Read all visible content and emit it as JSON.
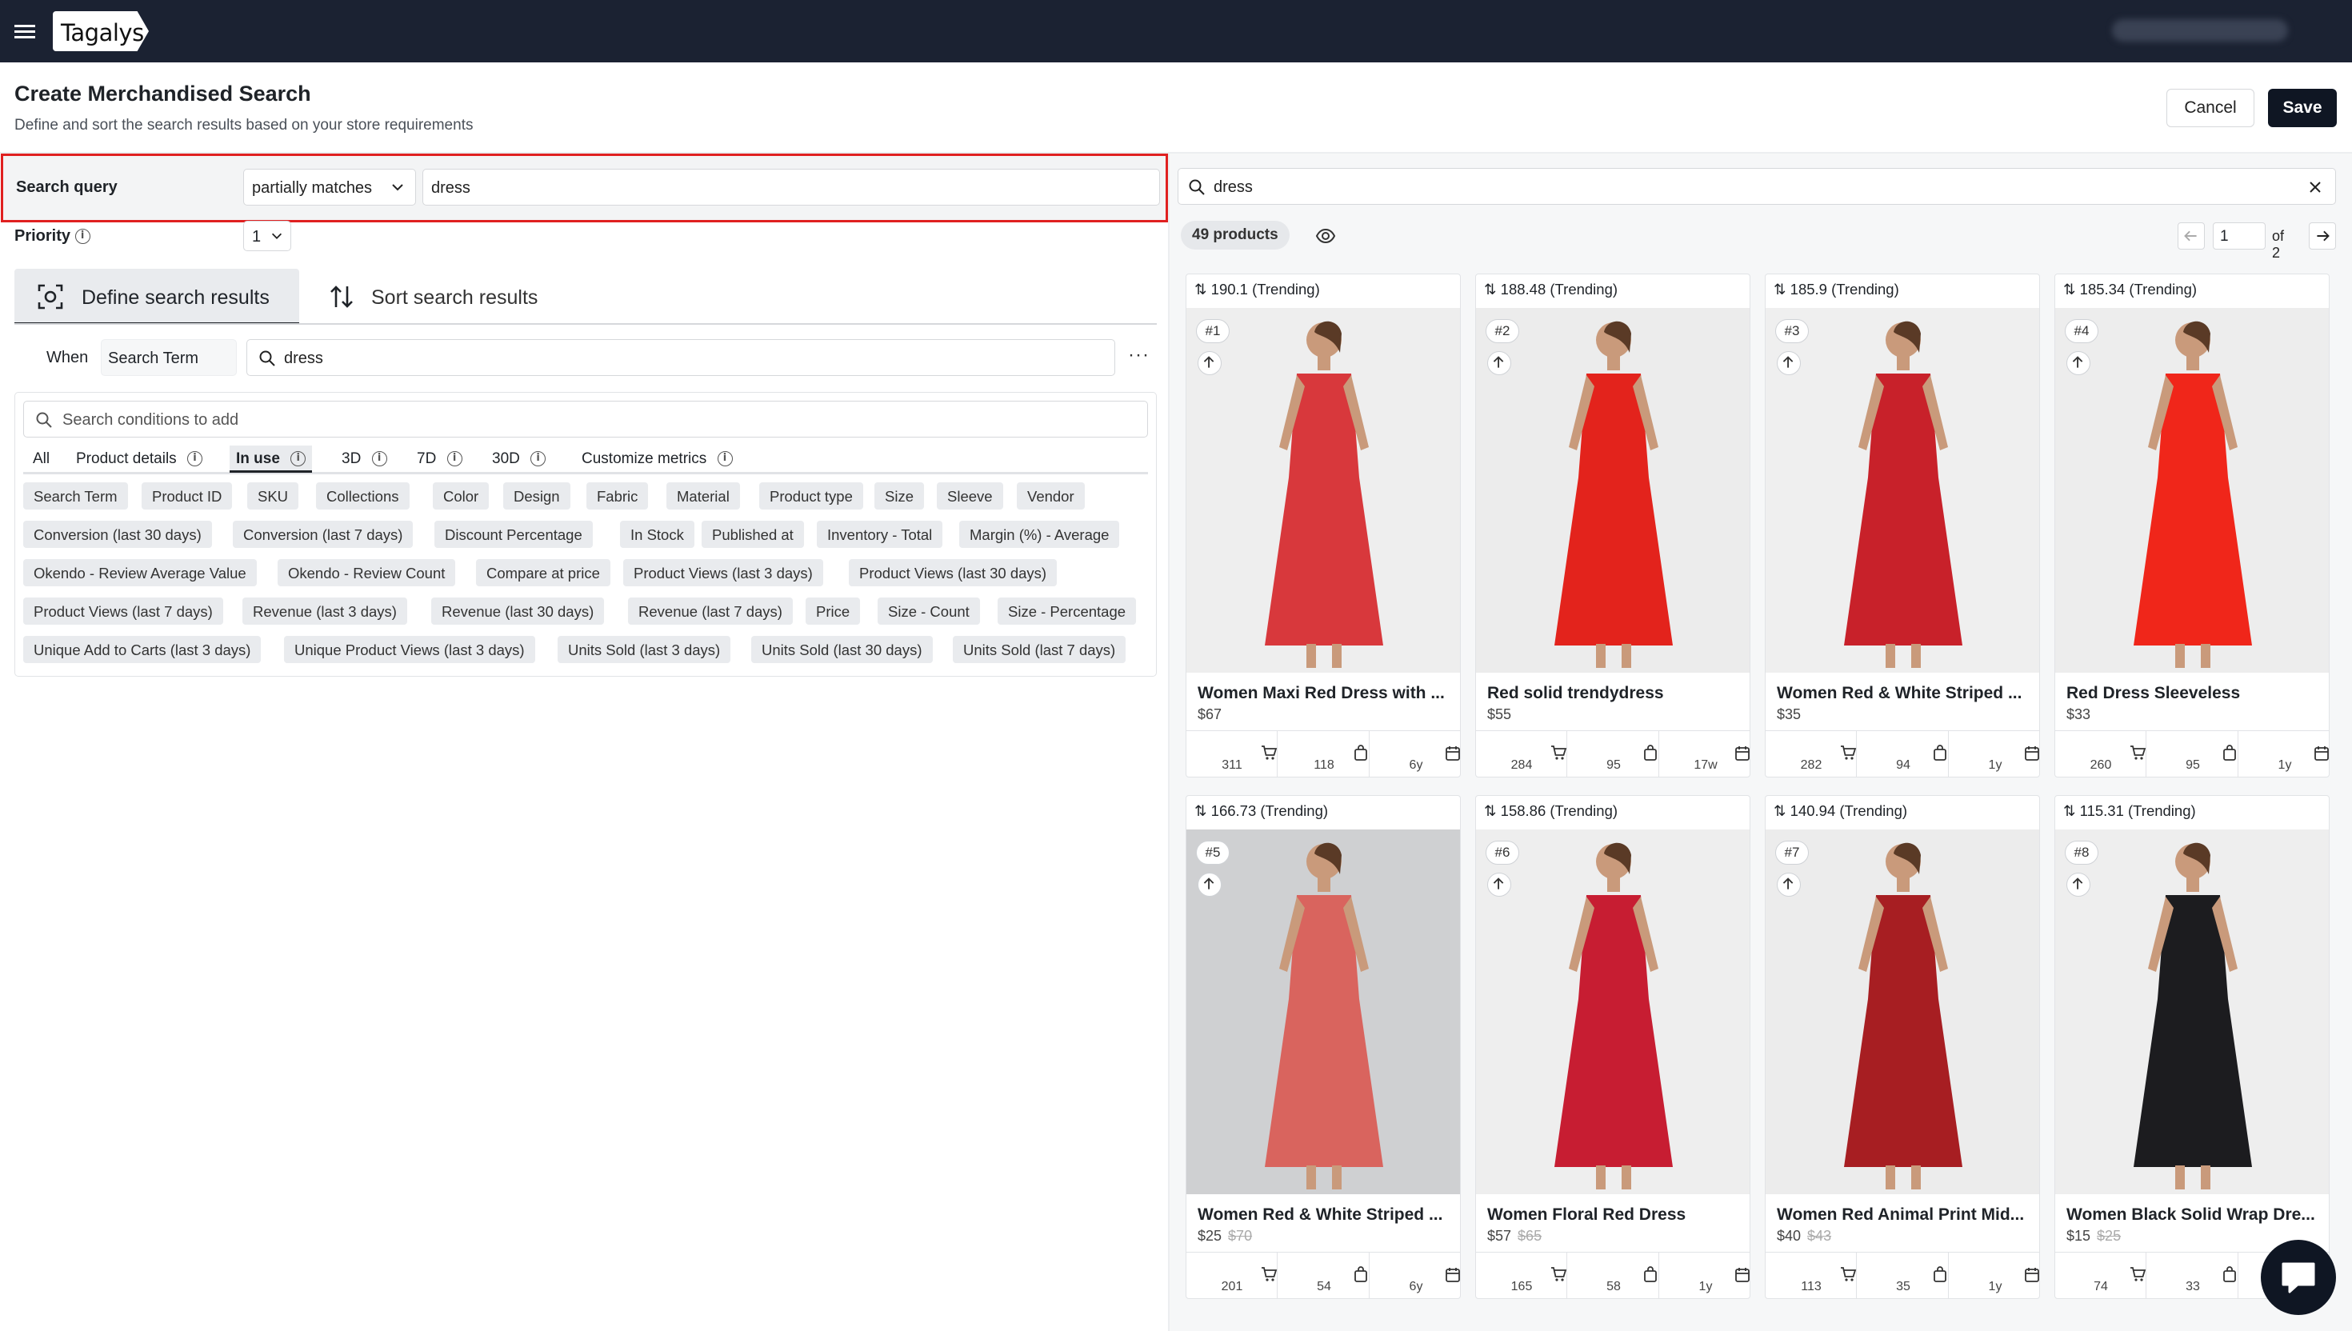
{
  "app": {
    "logo": "Tagalys"
  },
  "header": {
    "title": "Create Merchandised Search",
    "subtitle": "Define and sort the search results based on your store requirements",
    "cancel_label": "Cancel",
    "save_label": "Save"
  },
  "search_query": {
    "label": "Search query",
    "match_type": "partially matches",
    "value": "dress"
  },
  "priority": {
    "label": "Priority",
    "value": "1"
  },
  "tabs": [
    {
      "label": "Define search results",
      "active": true
    },
    {
      "label": "Sort search results",
      "active": false
    }
  ],
  "condition": {
    "when_label": "When",
    "field": "Search Term",
    "value": "dress"
  },
  "conditions_panel": {
    "search_placeholder": "Search conditions to add",
    "filters": [
      "All",
      "Product details",
      "In use",
      "3D",
      "7D",
      "30D",
      "Customize metrics"
    ],
    "active_filter": "In use",
    "chips": [
      [
        "Search Term",
        "Product ID",
        "SKU",
        "Collections",
        "Color",
        "Design",
        "Fabric",
        "Material",
        "Product type",
        "Size",
        "Sleeve",
        "Vendor"
      ],
      [
        "Conversion (last 30 days)",
        "Conversion (last 7 days)",
        "Discount Percentage",
        "In Stock",
        "Published at",
        "Inventory - Total",
        "Margin (%) - Average"
      ],
      [
        "Okendo - Review Average Value",
        "Okendo - Review Count",
        "Compare at price",
        "Product Views (last 3 days)",
        "Product Views (last 30 days)"
      ],
      [
        "Product Views (last 7 days)",
        "Revenue (last 3 days)",
        "Revenue (last 30 days)",
        "Revenue (last 7 days)",
        "Price",
        "Size - Count",
        "Size - Percentage"
      ],
      [
        "Unique Add to Carts (last 3 days)",
        "Unique Product Views (last 3 days)",
        "Units Sold (last 3 days)",
        "Units Sold (last 30 days)",
        "Units Sold (last 7 days)"
      ]
    ]
  },
  "results": {
    "search_value": "dress",
    "count_label": "49 products",
    "page": "1",
    "of_label": "of 2",
    "products": [
      {
        "score": "190.1 (Trending)",
        "rank": "#1",
        "name": "Women Maxi Red Dress with ...",
        "price": "$67",
        "orig": "",
        "carts": "311",
        "bags": "118",
        "age": "6y",
        "dress_color": "#d8383c",
        "bg": "#eeeeee"
      },
      {
        "score": "188.48 (Trending)",
        "rank": "#2",
        "name": "Red solid trendydress",
        "price": "$55",
        "orig": "",
        "carts": "284",
        "bags": "95",
        "age": "17w",
        "dress_color": "#e3231c",
        "bg": "#ececec"
      },
      {
        "score": "185.9 (Trending)",
        "rank": "#3",
        "name": "Women Red & White Striped ...",
        "price": "$35",
        "orig": "",
        "carts": "282",
        "bags": "94",
        "age": "1y",
        "dress_color": "#c8212a",
        "bg": "#efefef"
      },
      {
        "score": "185.34 (Trending)",
        "rank": "#4",
        "name": "Red Dress Sleeveless",
        "price": "$33",
        "orig": "",
        "carts": "260",
        "bags": "95",
        "age": "1y",
        "dress_color": "#f0261a",
        "bg": "#ededed"
      },
      {
        "score": "166.73 (Trending)",
        "rank": "#5",
        "name": "Women Red & White Striped ...",
        "price": "$25",
        "orig": "$70",
        "carts": "201",
        "bags": "54",
        "age": "6y",
        "dress_color": "#d9645e",
        "bg": "#cfd0d2"
      },
      {
        "score": "158.86 (Trending)",
        "rank": "#6",
        "name": "Women Floral Red Dress",
        "price": "$57",
        "orig": "$65",
        "carts": "165",
        "bags": "58",
        "age": "1y",
        "dress_color": "#c71d32",
        "bg": "#eeeeee"
      },
      {
        "score": "140.94 (Trending)",
        "rank": "#7",
        "name": "Women Red Animal Print Mid...",
        "price": "$40",
        "orig": "$43",
        "carts": "113",
        "bags": "35",
        "age": "1y",
        "dress_color": "#a71e22",
        "bg": "#ececec"
      },
      {
        "score": "115.31 (Trending)",
        "rank": "#8",
        "name": "Women Black Solid Wrap Dre...",
        "price": "$15",
        "orig": "$25",
        "carts": "74",
        "bags": "33",
        "age": "",
        "dress_color": "#1c1c1f",
        "bg": "#eeeeee"
      }
    ]
  },
  "colors": {
    "topbar": "#1b2232",
    "highlight_border": "#e02020",
    "primary_button": "#0f1623"
  }
}
